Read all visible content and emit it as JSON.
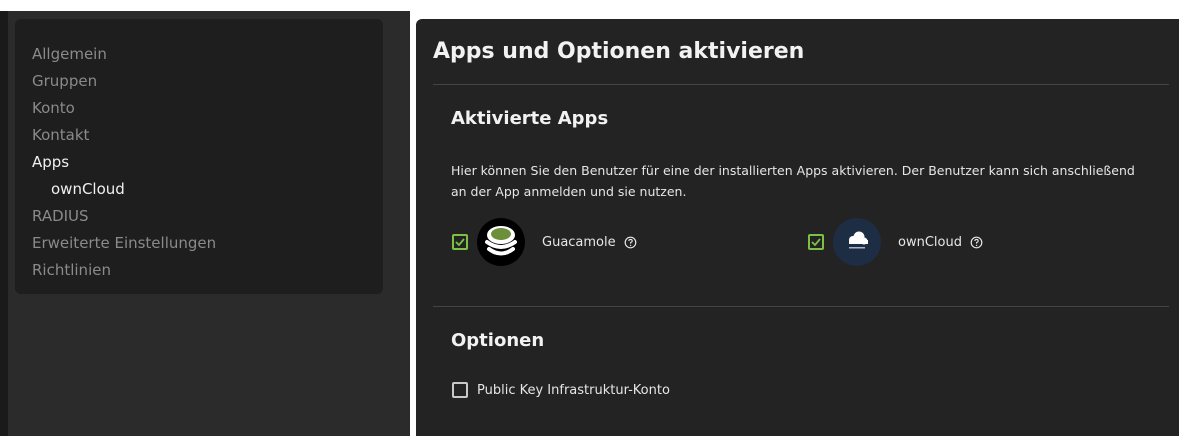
{
  "colors": {
    "accent_check": "#7cc143",
    "main_bg": "#232323",
    "nav_bg": "#1e1e1e",
    "nav_inactive": "#8a8a8a",
    "nav_active": "#f0f0f0"
  },
  "nav": {
    "items": [
      {
        "label": "Allgemein",
        "active": false
      },
      {
        "label": "Gruppen",
        "active": false
      },
      {
        "label": "Konto",
        "active": false
      },
      {
        "label": "Kontakt",
        "active": false
      },
      {
        "label": "Apps",
        "active": true
      },
      {
        "label": "ownCloud",
        "active": true,
        "sub": true
      },
      {
        "label": "RADIUS",
        "active": false
      },
      {
        "label": "Erweiterte Einstellungen",
        "active": false
      },
      {
        "label": "Richtlinien",
        "active": false
      }
    ]
  },
  "main": {
    "title": "Apps und Optionen aktivieren",
    "apps_section": {
      "title": "Aktivierte Apps",
      "description": "Hier können Sie den Benutzer für eine der installierten Apps aktivieren. Der Benutzer kann sich anschließend an der App anmelden und sie nutzen.",
      "apps": [
        {
          "name": "Guacamole",
          "checked": true,
          "icon": "guacamole-logo-icon"
        },
        {
          "name": "ownCloud",
          "checked": true,
          "icon": "owncloud-logo-icon"
        }
      ]
    },
    "options_section": {
      "title": "Optionen",
      "options": [
        {
          "label": "Public Key Infrastruktur-Konto",
          "checked": false
        }
      ]
    }
  }
}
